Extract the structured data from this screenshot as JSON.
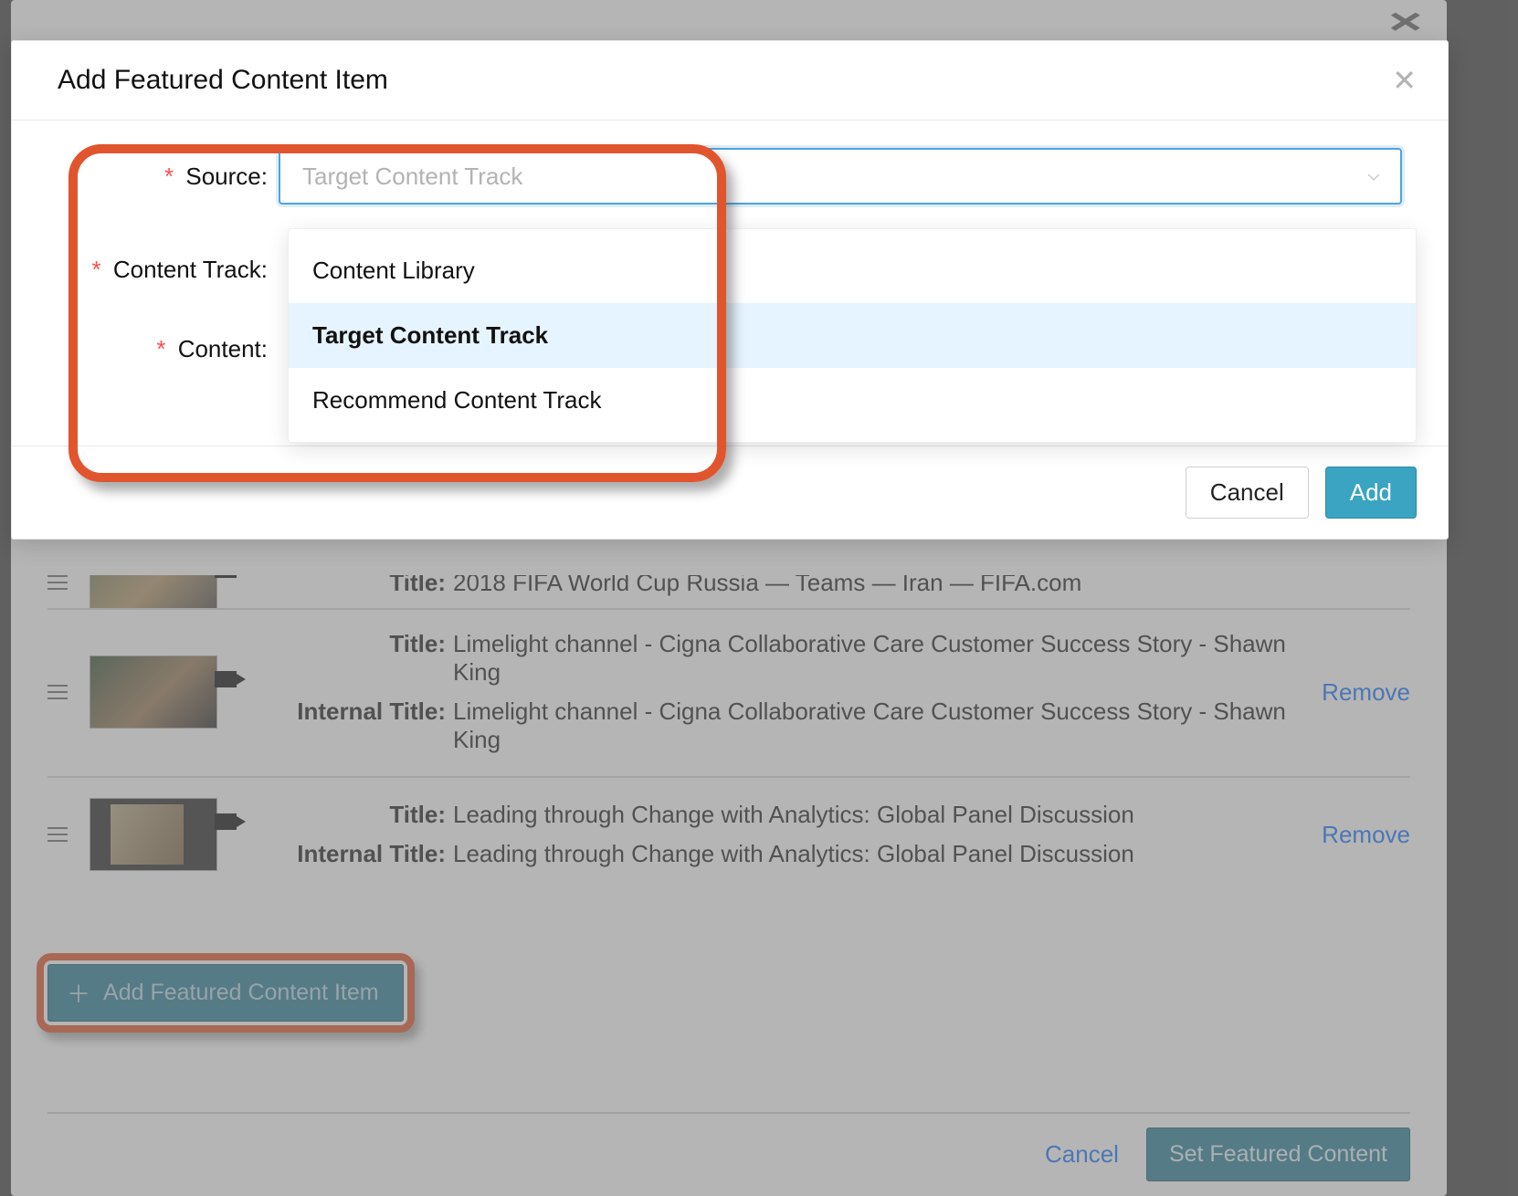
{
  "modal": {
    "title": "Add Featured Content Item",
    "fields": {
      "source_label": "Source",
      "source_placeholder": "Target Content Track",
      "content_track_label": "Content Track",
      "content_label": "Content"
    },
    "dropdown": {
      "items": [
        {
          "label": "Content Library",
          "selected": false
        },
        {
          "label": "Target Content Track",
          "selected": true
        },
        {
          "label": "Recommend Content Track",
          "selected": false
        }
      ]
    },
    "footer": {
      "cancel": "Cancel",
      "add": "Add"
    }
  },
  "background": {
    "rows": [
      {
        "title_label": "Title",
        "title": "2018 FIFA World Cup Russia — Teams — Iran — FIFA.com",
        "internal_label": "",
        "internal": ""
      },
      {
        "title_label": "Title",
        "title": "Limelight channel - Cigna Collaborative Care Customer Success Story - Shawn King",
        "internal_label": "Internal Title",
        "internal": "Limelight channel - Cigna Collaborative Care Customer Success Story - Shawn King"
      },
      {
        "title_label": "Title",
        "title": "Leading through Change with Analytics: Global Panel Discussion",
        "internal_label": "Internal Title",
        "internal": "Leading through Change with Analytics: Global Panel Discussion"
      }
    ],
    "remove_label": "Remove",
    "add_btn": "Add Featured Content Item",
    "footer": {
      "cancel": "Cancel",
      "set": "Set Featured Content"
    }
  },
  "colon": ":"
}
